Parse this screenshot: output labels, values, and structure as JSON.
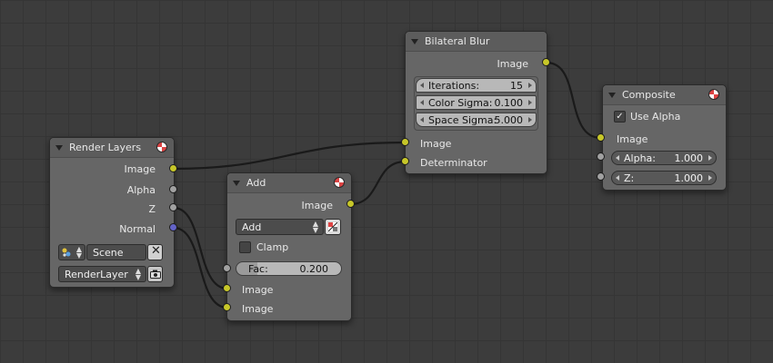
{
  "nodes": {
    "render_layers": {
      "title": "Render Layers",
      "outputs": [
        "Image",
        "Alpha",
        "Z",
        "Normal"
      ],
      "scene_value": "Scene",
      "layer_value": "RenderLayer"
    },
    "add": {
      "title": "Add",
      "output": "Image",
      "blend_mode": "Add",
      "clamp_label": "Clamp",
      "fac_label": "Fac:",
      "fac_value": "0.200",
      "inputs": [
        "Image",
        "Image"
      ]
    },
    "bilateral_blur": {
      "title": "Bilateral Blur",
      "output": "Image",
      "fields": [
        {
          "label": "Iterations:",
          "value": "15"
        },
        {
          "label": "Color Sigma:",
          "value": "0.100"
        },
        {
          "label": "Space Sigma:",
          "value": "5.000"
        }
      ],
      "inputs": [
        "Image",
        "Determinator"
      ]
    },
    "composite": {
      "title": "Composite",
      "use_alpha_label": "Use Alpha",
      "use_alpha_checked": true,
      "input_image": "Image",
      "alpha_label": "Alpha:",
      "alpha_value": "1.000",
      "z_label": "Z:",
      "z_value": "1.000"
    }
  },
  "icons": {
    "collapse": "triangle-down-icon",
    "preview": "render-preview-icon",
    "scene": "scene-icon",
    "clear": "x-icon",
    "camera": "render-camera-icon",
    "color_picker": "checker-icon"
  },
  "colors": {
    "socket_color": "#c7c729",
    "socket_value": "#a1a1a1",
    "socket_vector": "#6363c7",
    "link": "#1a1a1a"
  }
}
